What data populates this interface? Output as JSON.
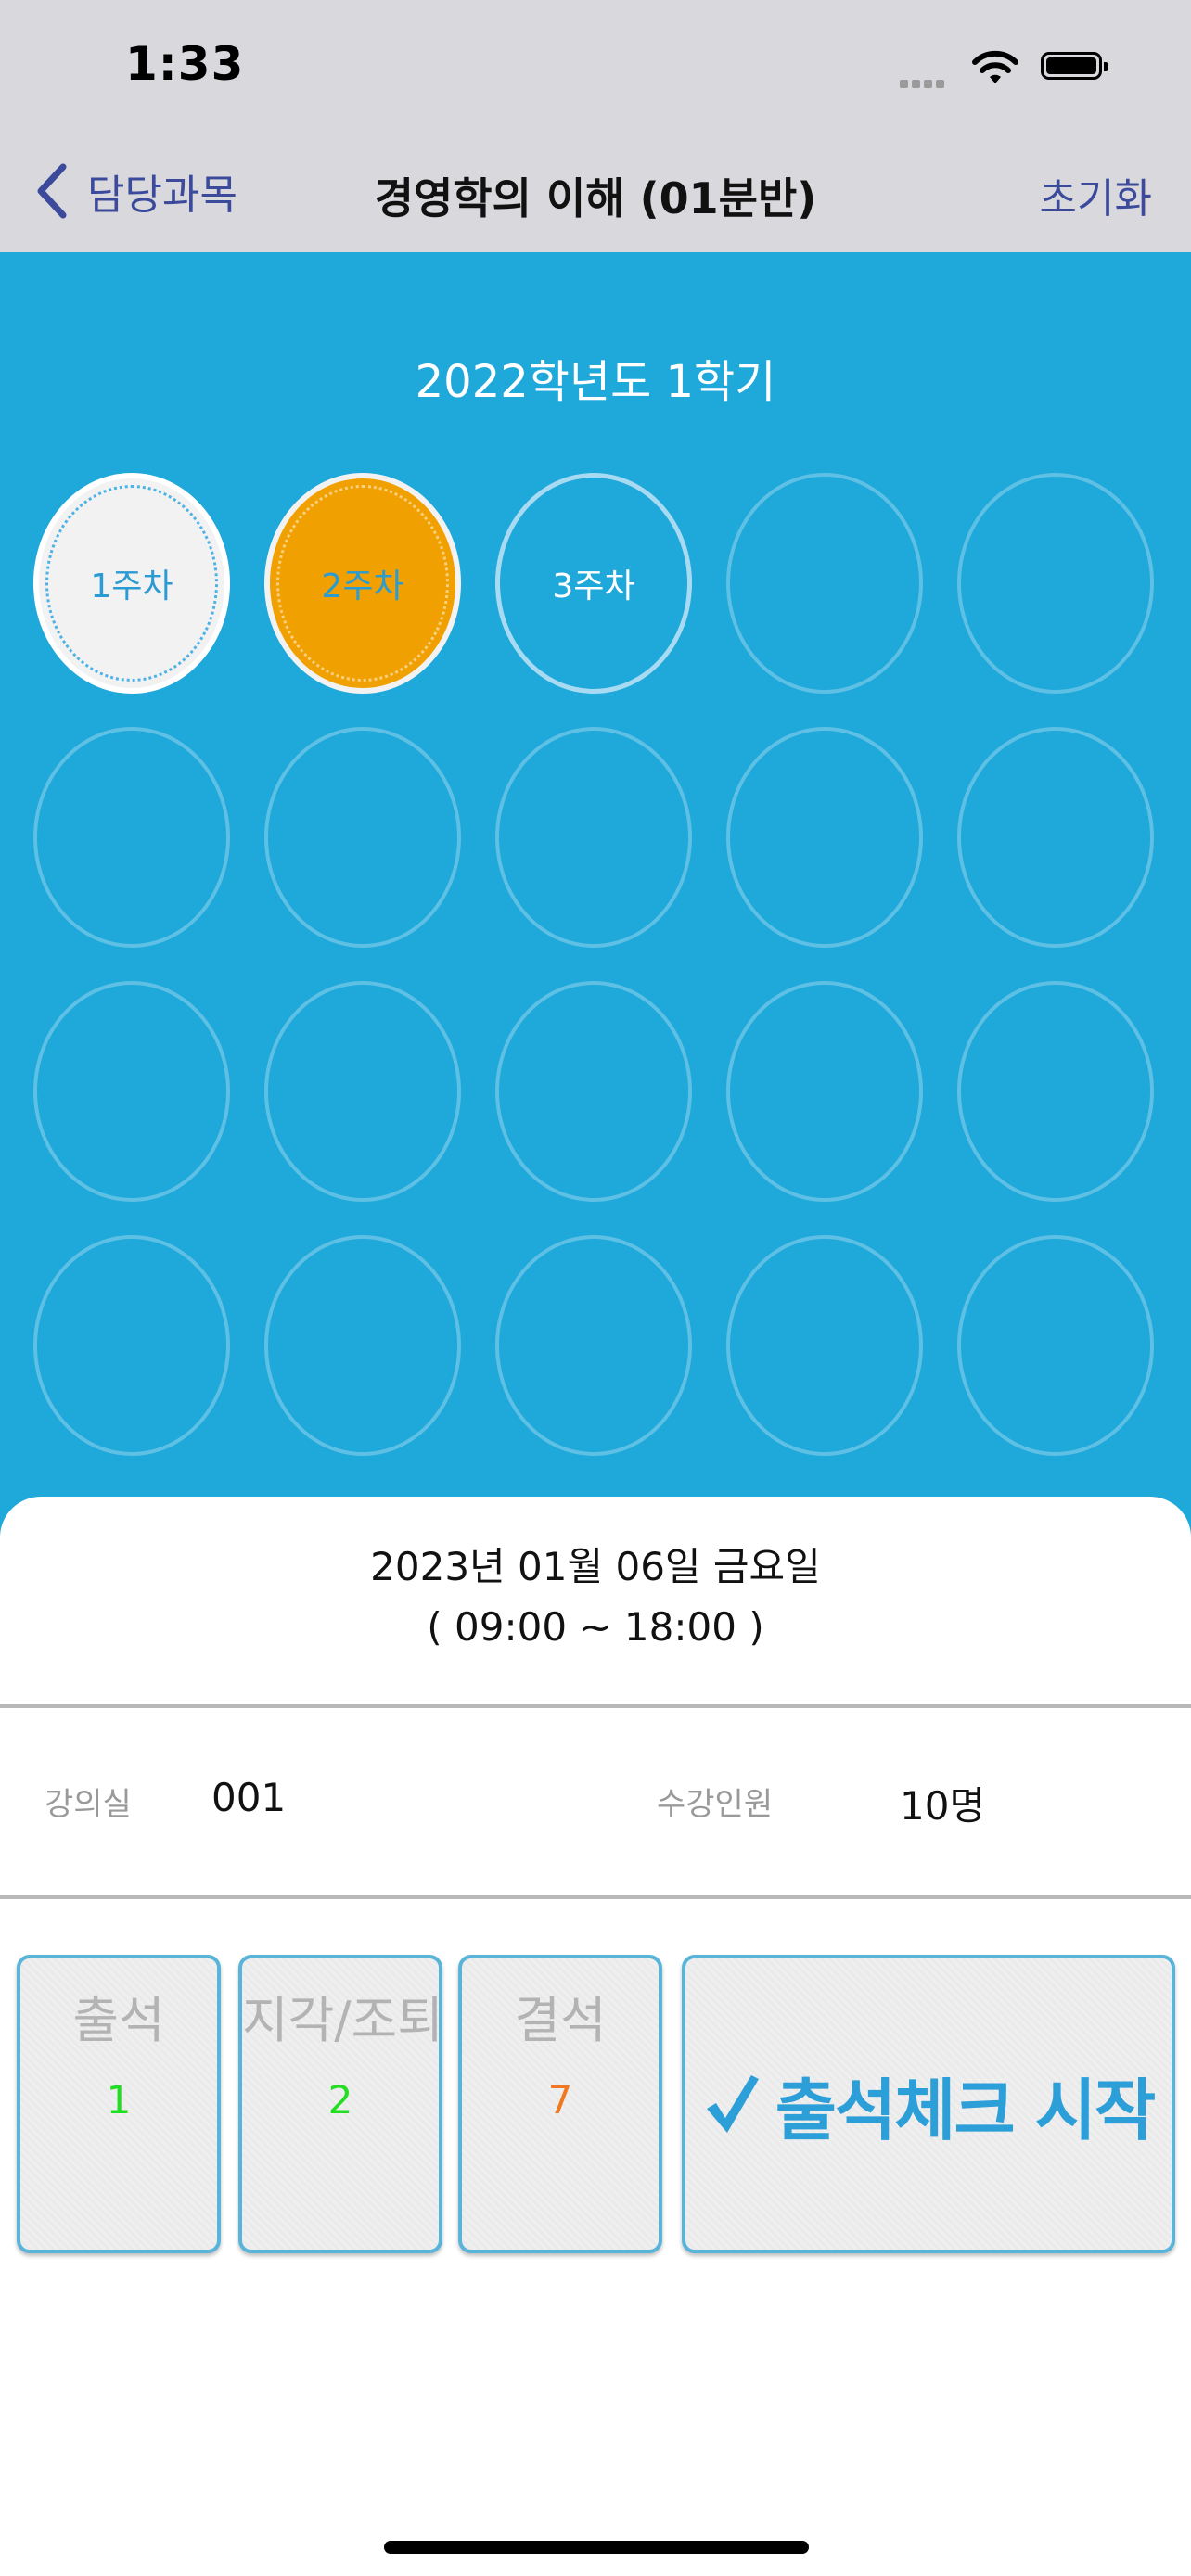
{
  "status_bar": {
    "time": "1:33"
  },
  "nav": {
    "back_label": "담당과목",
    "title": "경영학의 이해 (01분반)",
    "reset_label": "초기화"
  },
  "semester": "2022학년도 1학기",
  "weeks": [
    {
      "label": "1주차",
      "state": "done"
    },
    {
      "label": "2주차",
      "state": "current"
    },
    {
      "label": "3주차",
      "state": "upcoming"
    }
  ],
  "session": {
    "date": "2023년 01월 06일 금요일",
    "time_range": "( 09:00 ~ 18:00 )",
    "room_label": "강의실",
    "room_value": "001",
    "enrolled_label": "수강인원",
    "enrolled_value": "10명"
  },
  "stats": {
    "attend": {
      "label": "출석",
      "count": "1"
    },
    "late": {
      "label": "지각/조퇴",
      "count": "2"
    },
    "absent": {
      "label": "결석",
      "count": "7"
    }
  },
  "start_button": {
    "label": "출석체크 시작"
  },
  "colors": {
    "panel_blue": "#1fa8da",
    "current_week": "#f0a000",
    "nav_text": "#3b4a9a",
    "count_green": "#22dd22",
    "count_orange": "#f07820"
  }
}
